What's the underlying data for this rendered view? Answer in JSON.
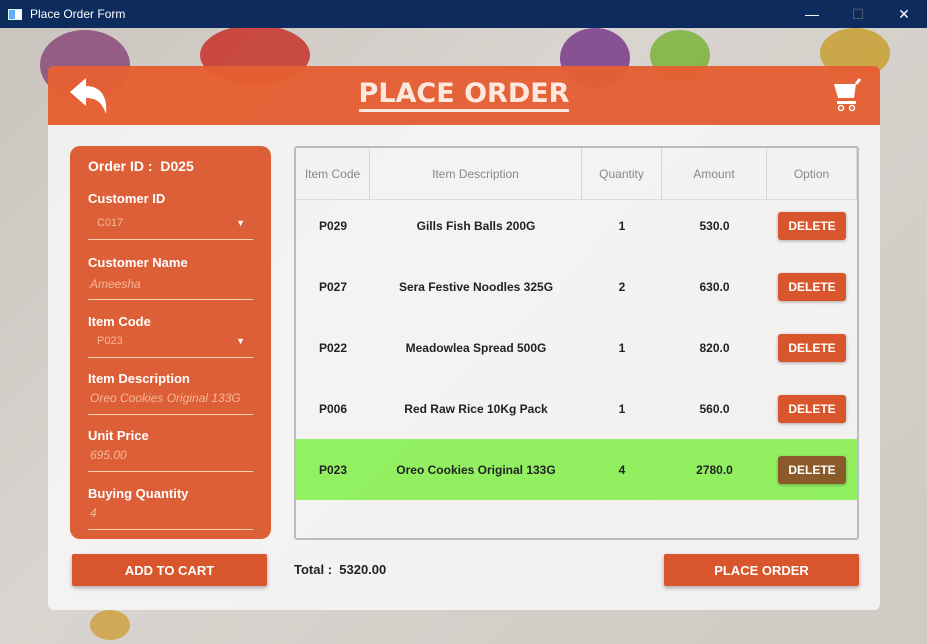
{
  "window": {
    "title": "Place Order Form",
    "minimize": "—",
    "maximize": "☐",
    "close": "✕"
  },
  "header": {
    "title": "PLACE ORDER",
    "back_icon": "back-arrow-icon",
    "cart_icon": "cart-icon"
  },
  "form": {
    "order_id_label": "Order ID :",
    "order_id": "D025",
    "customer_id_label": "Customer ID",
    "customer_id": "C017",
    "customer_name_label": "Customer Name",
    "customer_name": "Ameesha",
    "item_code_label": "Item Code",
    "item_code": "P023",
    "item_description_label": "Item Description",
    "item_description": "Oreo Cookies Original 133G",
    "unit_price_label": "Unit Price",
    "unit_price": "695.00",
    "buying_quantity_label": "Buying Quantity",
    "buying_quantity": "4"
  },
  "table": {
    "headers": [
      "Item Code",
      "Item Description",
      "Quantity",
      "Amount",
      "Option"
    ],
    "rows": [
      {
        "code": "P029",
        "desc": "Gills Fish Balls 200G",
        "qty": "1",
        "amount": "530.0",
        "option": "DELETE"
      },
      {
        "code": "P027",
        "desc": "Sera Festive Noodles 325G",
        "qty": "2",
        "amount": "630.0",
        "option": "DELETE"
      },
      {
        "code": "P022",
        "desc": "Meadowlea Spread 500G",
        "qty": "1",
        "amount": "820.0",
        "option": "DELETE"
      },
      {
        "code": "P006",
        "desc": "Red Raw Rice 10Kg Pack",
        "qty": "1",
        "amount": "560.0",
        "option": "DELETE"
      },
      {
        "code": "P023",
        "desc": "Oreo Cookies Original 133G",
        "qty": "4",
        "amount": "2780.0",
        "option": "DELETE"
      }
    ],
    "selected_row": 4
  },
  "footer": {
    "add_to_cart": "ADD TO CART",
    "total_label": "Total :",
    "total": "5320.00",
    "place_order": "PLACE ORDER"
  },
  "colors": {
    "accent": "#d9552b",
    "titlebar": "#0e2b5e",
    "selected": "#80f046"
  }
}
